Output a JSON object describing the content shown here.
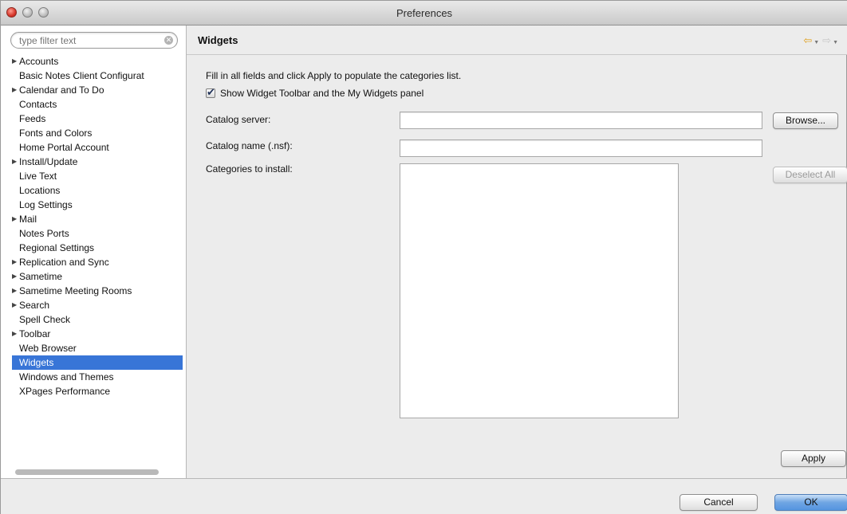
{
  "window": {
    "title": "Preferences"
  },
  "filter": {
    "placeholder": "type filter text",
    "clear_icon": "clear-search-icon"
  },
  "tree": {
    "items": [
      {
        "label": "Accounts",
        "expandable": true,
        "selected": false
      },
      {
        "label": "Basic Notes Client Configurat",
        "expandable": false,
        "selected": false
      },
      {
        "label": "Calendar and To Do",
        "expandable": true,
        "selected": false
      },
      {
        "label": "Contacts",
        "expandable": false,
        "selected": false
      },
      {
        "label": "Feeds",
        "expandable": false,
        "selected": false
      },
      {
        "label": "Fonts and Colors",
        "expandable": false,
        "selected": false
      },
      {
        "label": "Home Portal Account",
        "expandable": false,
        "selected": false
      },
      {
        "label": "Install/Update",
        "expandable": true,
        "selected": false
      },
      {
        "label": "Live Text",
        "expandable": false,
        "selected": false
      },
      {
        "label": "Locations",
        "expandable": false,
        "selected": false
      },
      {
        "label": "Log Settings",
        "expandable": false,
        "selected": false
      },
      {
        "label": "Mail",
        "expandable": true,
        "selected": false
      },
      {
        "label": "Notes Ports",
        "expandable": false,
        "selected": false
      },
      {
        "label": "Regional Settings",
        "expandable": false,
        "selected": false
      },
      {
        "label": "Replication and Sync",
        "expandable": true,
        "selected": false
      },
      {
        "label": "Sametime",
        "expandable": true,
        "selected": false
      },
      {
        "label": "Sametime Meeting Rooms",
        "expandable": true,
        "selected": false
      },
      {
        "label": "Search",
        "expandable": true,
        "selected": false
      },
      {
        "label": "Spell Check",
        "expandable": false,
        "selected": false
      },
      {
        "label": "Toolbar",
        "expandable": true,
        "selected": false
      },
      {
        "label": "Web Browser",
        "expandable": false,
        "selected": false
      },
      {
        "label": "Widgets",
        "expandable": false,
        "selected": true
      },
      {
        "label": "Windows and Themes",
        "expandable": false,
        "selected": false
      },
      {
        "label": "XPages Performance",
        "expandable": false,
        "selected": false
      }
    ]
  },
  "page": {
    "title": "Widgets",
    "instructions": "Fill in all fields and click Apply to populate the categories list.",
    "show_toolbar_label": "Show Widget Toolbar and the My Widgets panel",
    "show_toolbar_checked": true,
    "catalog_server_label": "Catalog server:",
    "catalog_server_value": "",
    "catalog_name_label": "Catalog name (.nsf):",
    "catalog_name_value": "",
    "categories_label": "Categories to install:",
    "browse_label": "Browse...",
    "deselect_all_label": "Deselect All",
    "apply_label": "Apply"
  },
  "nav": {
    "back_icon": "back-arrow-icon",
    "forward_icon": "forward-arrow-icon"
  },
  "footer": {
    "cancel_label": "Cancel",
    "ok_label": "OK"
  },
  "colors": {
    "selection": "#3875d7",
    "default_button": "#5595e0",
    "nav_back": "#e0a020"
  }
}
